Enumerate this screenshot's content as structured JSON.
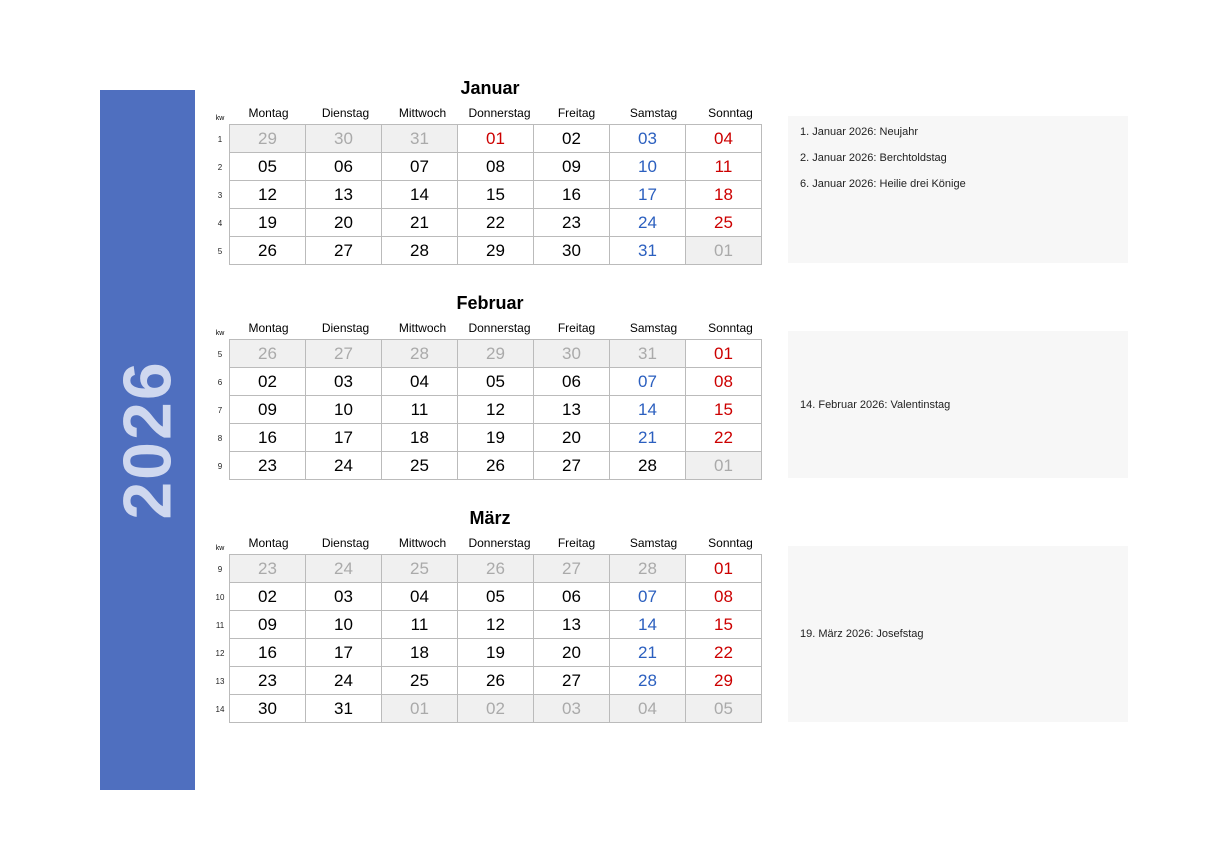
{
  "year": "2026",
  "kw_label": "kw",
  "weekdays": [
    "Montag",
    "Dienstag",
    "Mittwoch",
    "Donnerstag",
    "Freitag",
    "Samstag",
    "Sonntag"
  ],
  "months": [
    {
      "name": "Januar",
      "notes_center": false,
      "notes": [
        "1. Januar 2026: Neujahr",
        "2. Januar 2026: Berchtoldstag",
        "6. Januar 2026: Heilie drei Könige"
      ],
      "rows": [
        {
          "kw": "1",
          "days": [
            {
              "d": "29",
              "s": "dim"
            },
            {
              "d": "30",
              "s": "dim"
            },
            {
              "d": "31",
              "s": "dim"
            },
            {
              "d": "01",
              "s": "red"
            },
            {
              "d": "02",
              "s": ""
            },
            {
              "d": "03",
              "s": "blue"
            },
            {
              "d": "04",
              "s": "red"
            }
          ]
        },
        {
          "kw": "2",
          "days": [
            {
              "d": "05",
              "s": ""
            },
            {
              "d": "06",
              "s": ""
            },
            {
              "d": "07",
              "s": ""
            },
            {
              "d": "08",
              "s": ""
            },
            {
              "d": "09",
              "s": ""
            },
            {
              "d": "10",
              "s": "blue"
            },
            {
              "d": "11",
              "s": "red"
            }
          ]
        },
        {
          "kw": "3",
          "days": [
            {
              "d": "12",
              "s": ""
            },
            {
              "d": "13",
              "s": ""
            },
            {
              "d": "14",
              "s": ""
            },
            {
              "d": "15",
              "s": ""
            },
            {
              "d": "16",
              "s": ""
            },
            {
              "d": "17",
              "s": "blue"
            },
            {
              "d": "18",
              "s": "red"
            }
          ]
        },
        {
          "kw": "4",
          "days": [
            {
              "d": "19",
              "s": ""
            },
            {
              "d": "20",
              "s": ""
            },
            {
              "d": "21",
              "s": ""
            },
            {
              "d": "22",
              "s": ""
            },
            {
              "d": "23",
              "s": ""
            },
            {
              "d": "24",
              "s": "blue"
            },
            {
              "d": "25",
              "s": "red"
            }
          ]
        },
        {
          "kw": "5",
          "days": [
            {
              "d": "26",
              "s": ""
            },
            {
              "d": "27",
              "s": ""
            },
            {
              "d": "28",
              "s": ""
            },
            {
              "d": "29",
              "s": ""
            },
            {
              "d": "30",
              "s": ""
            },
            {
              "d": "31",
              "s": "blue"
            },
            {
              "d": "01",
              "s": "dim"
            }
          ]
        }
      ]
    },
    {
      "name": "Februar",
      "notes_center": true,
      "notes": [
        "14. Februar 2026: Valentinstag"
      ],
      "rows": [
        {
          "kw": "5",
          "days": [
            {
              "d": "26",
              "s": "dim"
            },
            {
              "d": "27",
              "s": "dim"
            },
            {
              "d": "28",
              "s": "dim"
            },
            {
              "d": "29",
              "s": "dim"
            },
            {
              "d": "30",
              "s": "dim"
            },
            {
              "d": "31",
              "s": "dim"
            },
            {
              "d": "01",
              "s": "red"
            }
          ]
        },
        {
          "kw": "6",
          "days": [
            {
              "d": "02",
              "s": ""
            },
            {
              "d": "03",
              "s": ""
            },
            {
              "d": "04",
              "s": ""
            },
            {
              "d": "05",
              "s": ""
            },
            {
              "d": "06",
              "s": ""
            },
            {
              "d": "07",
              "s": "blue"
            },
            {
              "d": "08",
              "s": "red"
            }
          ]
        },
        {
          "kw": "7",
          "days": [
            {
              "d": "09",
              "s": ""
            },
            {
              "d": "10",
              "s": ""
            },
            {
              "d": "11",
              "s": ""
            },
            {
              "d": "12",
              "s": ""
            },
            {
              "d": "13",
              "s": ""
            },
            {
              "d": "14",
              "s": "blue"
            },
            {
              "d": "15",
              "s": "red"
            }
          ]
        },
        {
          "kw": "8",
          "days": [
            {
              "d": "16",
              "s": ""
            },
            {
              "d": "17",
              "s": ""
            },
            {
              "d": "18",
              "s": ""
            },
            {
              "d": "19",
              "s": ""
            },
            {
              "d": "20",
              "s": ""
            },
            {
              "d": "21",
              "s": "blue"
            },
            {
              "d": "22",
              "s": "red"
            }
          ]
        },
        {
          "kw": "9",
          "days": [
            {
              "d": "23",
              "s": ""
            },
            {
              "d": "24",
              "s": ""
            },
            {
              "d": "25",
              "s": ""
            },
            {
              "d": "26",
              "s": ""
            },
            {
              "d": "27",
              "s": ""
            },
            {
              "d": "28",
              "s": ""
            },
            {
              "d": "01",
              "s": "dim"
            }
          ]
        }
      ]
    },
    {
      "name": "März",
      "notes_center": true,
      "notes": [
        "19. März 2026: Josefstag"
      ],
      "rows": [
        {
          "kw": "9",
          "days": [
            {
              "d": "23",
              "s": "dim"
            },
            {
              "d": "24",
              "s": "dim"
            },
            {
              "d": "25",
              "s": "dim"
            },
            {
              "d": "26",
              "s": "dim"
            },
            {
              "d": "27",
              "s": "dim"
            },
            {
              "d": "28",
              "s": "dim"
            },
            {
              "d": "01",
              "s": "red"
            }
          ]
        },
        {
          "kw": "10",
          "days": [
            {
              "d": "02",
              "s": ""
            },
            {
              "d": "03",
              "s": ""
            },
            {
              "d": "04",
              "s": ""
            },
            {
              "d": "05",
              "s": ""
            },
            {
              "d": "06",
              "s": ""
            },
            {
              "d": "07",
              "s": "blue"
            },
            {
              "d": "08",
              "s": "red"
            }
          ]
        },
        {
          "kw": "11",
          "days": [
            {
              "d": "09",
              "s": ""
            },
            {
              "d": "10",
              "s": ""
            },
            {
              "d": "11",
              "s": ""
            },
            {
              "d": "12",
              "s": ""
            },
            {
              "d": "13",
              "s": ""
            },
            {
              "d": "14",
              "s": "blue"
            },
            {
              "d": "15",
              "s": "red"
            }
          ]
        },
        {
          "kw": "12",
          "days": [
            {
              "d": "16",
              "s": ""
            },
            {
              "d": "17",
              "s": ""
            },
            {
              "d": "18",
              "s": ""
            },
            {
              "d": "19",
              "s": ""
            },
            {
              "d": "20",
              "s": ""
            },
            {
              "d": "21",
              "s": "blue"
            },
            {
              "d": "22",
              "s": "red"
            }
          ]
        },
        {
          "kw": "13",
          "days": [
            {
              "d": "23",
              "s": ""
            },
            {
              "d": "24",
              "s": ""
            },
            {
              "d": "25",
              "s": ""
            },
            {
              "d": "26",
              "s": ""
            },
            {
              "d": "27",
              "s": ""
            },
            {
              "d": "28",
              "s": "blue"
            },
            {
              "d": "29",
              "s": "red"
            }
          ]
        },
        {
          "kw": "14",
          "days": [
            {
              "d": "30",
              "s": ""
            },
            {
              "d": "31",
              "s": ""
            },
            {
              "d": "01",
              "s": "dim"
            },
            {
              "d": "02",
              "s": "dim"
            },
            {
              "d": "03",
              "s": "dim"
            },
            {
              "d": "04",
              "s": "dim"
            },
            {
              "d": "05",
              "s": "dim"
            }
          ]
        }
      ]
    }
  ]
}
